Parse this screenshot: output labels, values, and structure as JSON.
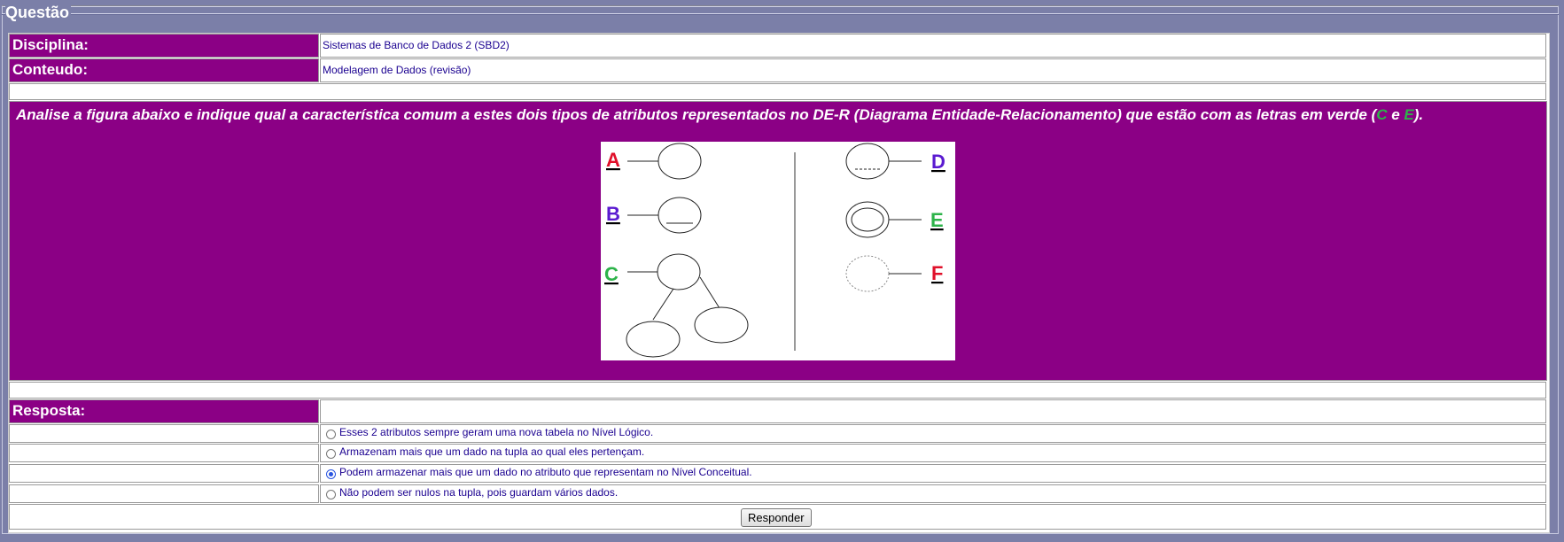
{
  "legend": "Questão",
  "fields": {
    "disciplina_label": "Disciplina:",
    "disciplina_value": "Sistemas de Banco de Dados 2 (SBD2)",
    "conteudo_label": "Conteudo:",
    "conteudo_value": "Modelagem de Dados (revisão)"
  },
  "question": {
    "text_before": "Analise a figura abaixo e indique qual a característica comum a estes dois tipos de atributos representados no DE-R (Diagrama Entidade-Relacionamento) que estão com as letras em verde (",
    "letter_c": "C",
    "conj": " e ",
    "letter_e": "E",
    "text_after": ").",
    "figure_letters": {
      "a": "A",
      "b": "B",
      "c": "C",
      "d": "D",
      "e": "E",
      "f": "F"
    }
  },
  "answer": {
    "label": "Resposta:",
    "options": [
      {
        "text": "Esses 2 atributos sempre geram uma nova tabela no Nível Lógico.",
        "selected": false
      },
      {
        "text": "Armazenam mais que um dado na tupla ao qual eles pertençam.",
        "selected": false
      },
      {
        "text": "Podem armazenar mais que um dado no atributo que representam no Nível Conceitual.",
        "selected": true
      },
      {
        "text": "Não podem ser nulos na tupla, pois guardam vários dados.",
        "selected": false
      }
    ],
    "submit_label": "Responder"
  },
  "colors": {
    "label_bg": "#8b0085",
    "page_bg": "#7b7fa8",
    "letter_red": "#e0102a",
    "letter_purple": "#5a1ad0",
    "letter_green": "#2db34a"
  }
}
